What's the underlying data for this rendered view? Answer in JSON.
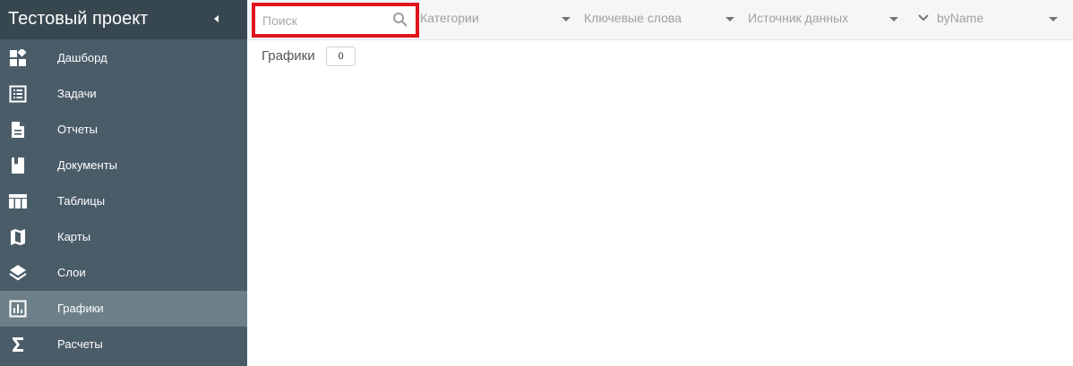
{
  "sidebar": {
    "project_title": "Тестовый проект",
    "items": [
      {
        "label": "Дашборд",
        "icon": "dashboard-icon"
      },
      {
        "label": "Задачи",
        "icon": "task-list-icon"
      },
      {
        "label": "Отчеты",
        "icon": "report-file-icon"
      },
      {
        "label": "Документы",
        "icon": "book-icon"
      },
      {
        "label": "Таблицы",
        "icon": "table-icon"
      },
      {
        "label": "Карты",
        "icon": "map-icon"
      },
      {
        "label": "Слои",
        "icon": "layers-icon"
      },
      {
        "label": "Графики",
        "icon": "bar-chart-icon",
        "active": true
      },
      {
        "label": "Расчеты",
        "icon": "sigma-icon"
      }
    ]
  },
  "filters": {
    "search_placeholder": "Поиск",
    "search_value": "",
    "categories": "Категории",
    "keywords": "Ключевые слова",
    "data_source": "Источник данных",
    "sort": "byName"
  },
  "content": {
    "section_title": "Графики",
    "count": "0"
  },
  "colors": {
    "sidebar_bg": "#4a5c68",
    "sidebar_header_bg": "#37474f",
    "active_item_bg": "#6d8089",
    "highlight_border": "#e0141c"
  }
}
